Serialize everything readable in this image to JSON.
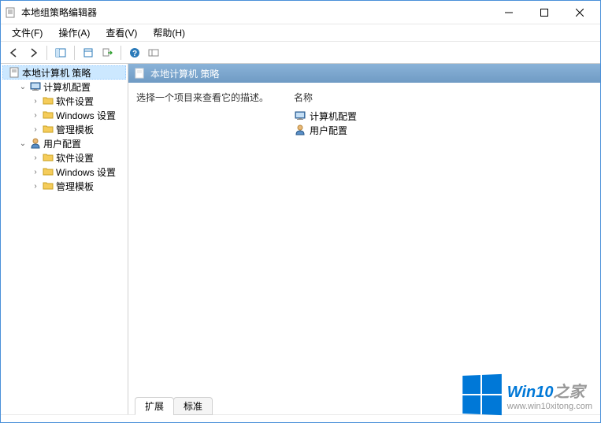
{
  "window": {
    "title": "本地组策略编辑器"
  },
  "menu": {
    "file": "文件(F)",
    "action": "操作(A)",
    "view": "查看(V)",
    "help": "帮助(H)"
  },
  "tree": {
    "root": "本地计算机 策略",
    "computer": "计算机配置",
    "user": "用户配置",
    "software": "软件设置",
    "windows": "Windows 设置",
    "admin": "管理模板"
  },
  "header": {
    "title": "本地计算机 策略"
  },
  "details": {
    "description": "选择一个项目来查看它的描述。",
    "name_header": "名称",
    "items": {
      "computer": "计算机配置",
      "user": "用户配置"
    }
  },
  "tabs": {
    "extended": "扩展",
    "standard": "标准"
  },
  "watermark": {
    "brand_main": "Win10",
    "brand_suffix": "之家",
    "url": "www.win10xitong.com"
  }
}
